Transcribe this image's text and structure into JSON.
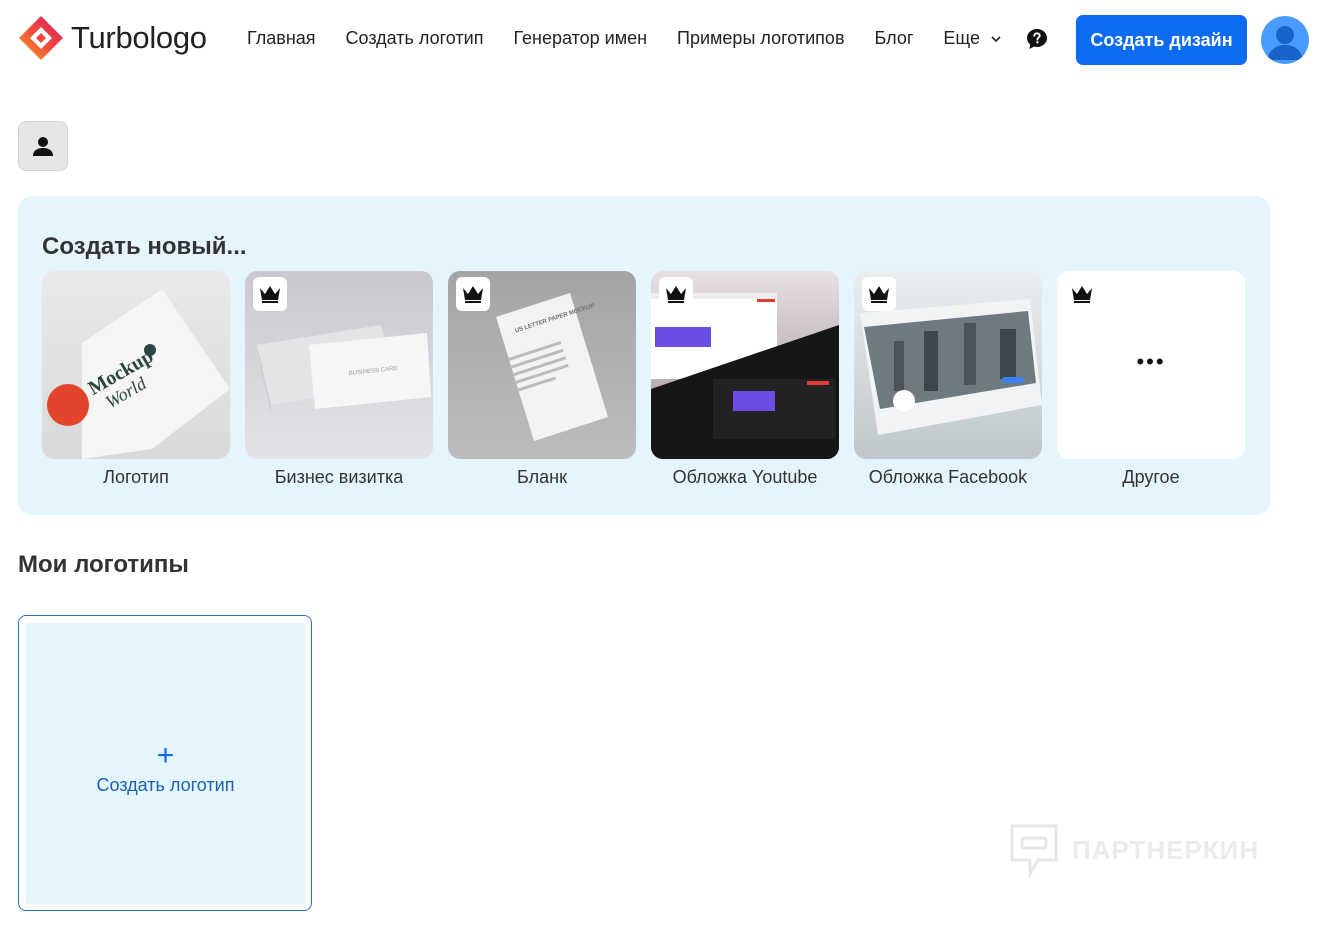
{
  "brand": {
    "name": "Turbologo"
  },
  "nav": {
    "items": [
      "Главная",
      "Создать логотип",
      "Генератор имен",
      "Примеры логотипов",
      "Блог"
    ],
    "more_label": "Еще"
  },
  "header": {
    "cta_label": "Создать дизайн"
  },
  "create": {
    "title": "Создать новый...",
    "cards": [
      {
        "label": "Логотип",
        "premium": false
      },
      {
        "label": "Бизнес визитка",
        "premium": true
      },
      {
        "label": "Бланк",
        "premium": true
      },
      {
        "label": "Обложка Youtube",
        "premium": true
      },
      {
        "label": "Обложка Facebook",
        "premium": true
      },
      {
        "label": "Другое",
        "premium": true
      }
    ]
  },
  "my_logos": {
    "title": "Мои логотипы",
    "create_label": "Создать логотип",
    "plus": "+"
  },
  "thumb_text": {
    "logo_mockup": "Mockup",
    "logo_world": "World",
    "biz_card": "BUSINESS CARD",
    "blank_title": "US LETTER PAPER MOCKUP",
    "more_dots": "•••"
  },
  "watermark": {
    "text": "ПАРТНЕРКИН"
  },
  "colors": {
    "accent": "#0b6cf2",
    "panel_bg": "#e4f5fd",
    "avatar": "#4a9bff"
  },
  "icons": {
    "help": "question-circle-icon",
    "more": "chevron-down-icon",
    "premium": "crown-icon",
    "profile": "user-icon"
  }
}
